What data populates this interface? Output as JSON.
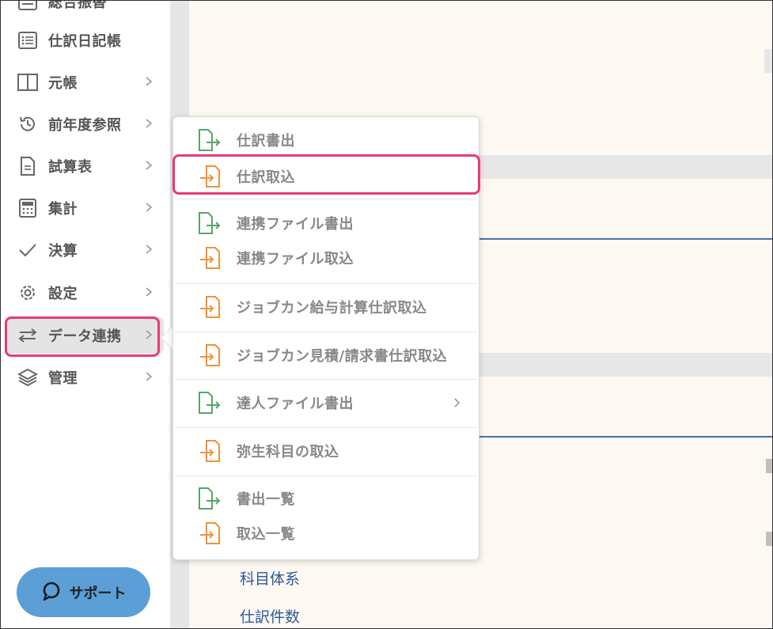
{
  "sidebar": {
    "items": [
      {
        "label": "総合振替",
        "icon": "list-icon"
      },
      {
        "label": "仕訳日記帳",
        "icon": "list-icon"
      },
      {
        "label": "元帳",
        "icon": "book-icon"
      },
      {
        "label": "前年度参照",
        "icon": "history-icon"
      },
      {
        "label": "試算表",
        "icon": "document-icon"
      },
      {
        "label": "集計",
        "icon": "calculator-icon"
      },
      {
        "label": "決算",
        "icon": "check-icon"
      },
      {
        "label": "設定",
        "icon": "gear-icon"
      },
      {
        "label": "データ連携",
        "icon": "swap-arrows-icon"
      },
      {
        "label": "管理",
        "icon": "layers-icon"
      }
    ],
    "support_label": "サポート"
  },
  "menu": {
    "items": [
      {
        "label": "仕訳書出",
        "icon": "export-file-icon",
        "color": "#5aa469"
      },
      {
        "label": "仕訳取込",
        "icon": "import-file-icon",
        "color": "#f0923a"
      },
      {
        "label": "連携ファイル書出",
        "icon": "export-file-icon",
        "color": "#5aa469"
      },
      {
        "label": "連携ファイル取込",
        "icon": "import-file-icon",
        "color": "#f0923a"
      },
      {
        "label": "ジョブカン給与計算仕訳取込",
        "icon": "import-file-icon",
        "color": "#f0923a"
      },
      {
        "label": "ジョブカン見積/請求書仕訳取込",
        "icon": "import-file-icon",
        "color": "#f0923a"
      },
      {
        "label": "達人ファイル書出",
        "icon": "export-file-icon",
        "color": "#5aa469"
      },
      {
        "label": "弥生科目の取込",
        "icon": "import-file-icon",
        "color": "#f0923a"
      },
      {
        "label": "書出一覧",
        "icon": "export-file-icon",
        "color": "#5aa469"
      },
      {
        "label": "取込一覧",
        "icon": "import-file-icon",
        "color": "#f0923a"
      }
    ]
  },
  "main": {
    "links": [
      "科目体系",
      "仕訳件数"
    ]
  },
  "colors": {
    "highlight": "#e83a7a",
    "export": "#5aa469",
    "import": "#f0923a",
    "support": "#5b9fd6",
    "link": "#2d5a9a",
    "content_bg": "#fdf8f1"
  }
}
